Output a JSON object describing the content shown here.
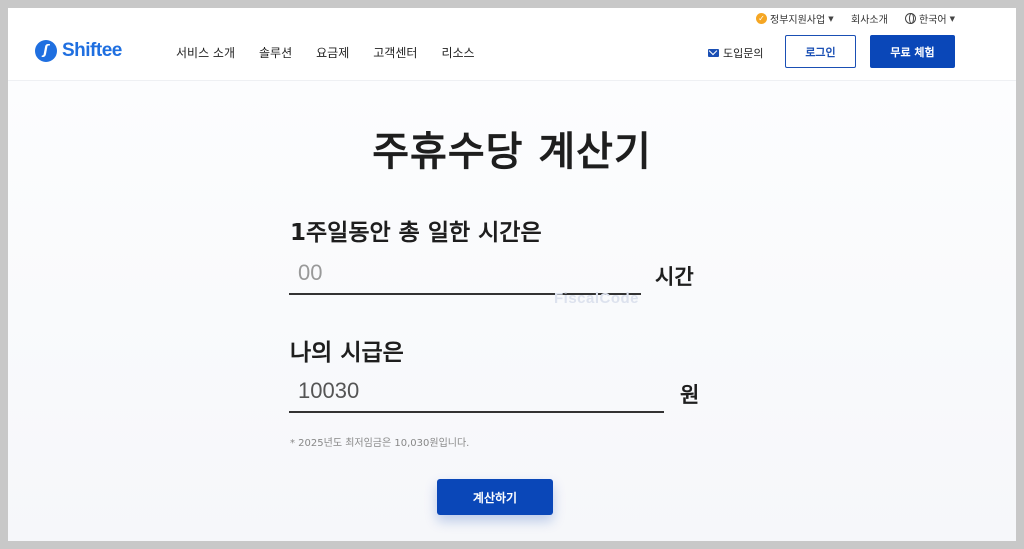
{
  "utility": {
    "gov_program": "정부지원사업",
    "company": "회사소개",
    "language": "한국어"
  },
  "header": {
    "logo_text": "Shiftee",
    "nav": [
      "서비스 소개",
      "솔루션",
      "요금제",
      "고객센터",
      "리소스"
    ],
    "inquiry": "도입문의",
    "login": "로그인",
    "trial": "무료 체험"
  },
  "main": {
    "title": "주휴수당 계산기",
    "hours_label": "1주일동안 총 일한 시간은",
    "hours_placeholder": "00",
    "hours_unit": "시간",
    "wage_label": "나의 시급은",
    "wage_value": "10030",
    "wage_unit": "원",
    "note": "* 2025년도 최저임금은 10,030원입니다.",
    "watermark": "FiscalCode",
    "calc_button": "계산하기"
  },
  "colors": {
    "brand": "#1f6fe0",
    "primary_button": "#0a47b8",
    "gov_badge": "#f5a623"
  }
}
